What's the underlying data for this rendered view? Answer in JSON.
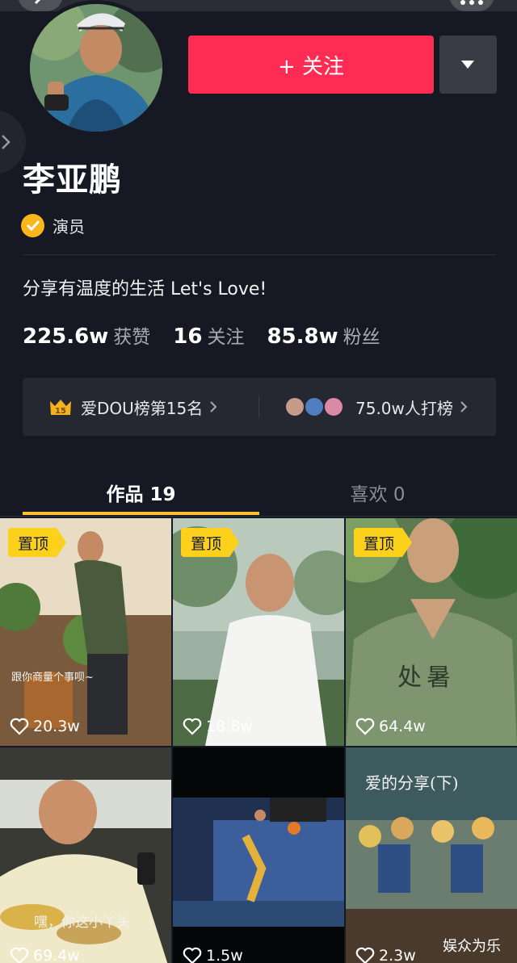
{
  "header": {
    "back_icon": "chevron-left-icon",
    "more_icon": "more-dots-icon"
  },
  "profile": {
    "follow_label": "+ 关注",
    "name": "李亚鹏",
    "verify_label": "演员",
    "bio": "分享有温度的生活 Let's Love!",
    "stats": [
      {
        "num": "225.6w",
        "label": "获赞"
      },
      {
        "num": "16",
        "label": "关注"
      },
      {
        "num": "85.8w",
        "label": "粉丝"
      }
    ]
  },
  "rank": {
    "badge_number": "15",
    "left_label": "爱DOU榜第15名",
    "right_label": "75.0w人打榜"
  },
  "tabs": [
    {
      "label": "作品 19"
    },
    {
      "label": "喜欢 0"
    }
  ],
  "videos": [
    {
      "pinned": "置顶",
      "likes": "20.3w",
      "caption": "跟你商量个事呗~"
    },
    {
      "pinned": "置顶",
      "likes": "18.8w",
      "caption": ""
    },
    {
      "pinned": "置顶",
      "likes": "64.4w",
      "caption": "处暑"
    },
    {
      "pinned": "",
      "likes": "69.4w",
      "caption": "嘿，你这小丫头"
    },
    {
      "pinned": "",
      "likes": "1.5w",
      "caption": ""
    },
    {
      "pinned": "",
      "likes": "2.3w",
      "caption": "爱的分享(下)"
    }
  ],
  "watermark": "娱众为乐",
  "colors": {
    "background": "#161823",
    "follow": "#fe2c55",
    "accent_yellow": "#fbc12e",
    "verify_badge": "#f9b71b"
  }
}
